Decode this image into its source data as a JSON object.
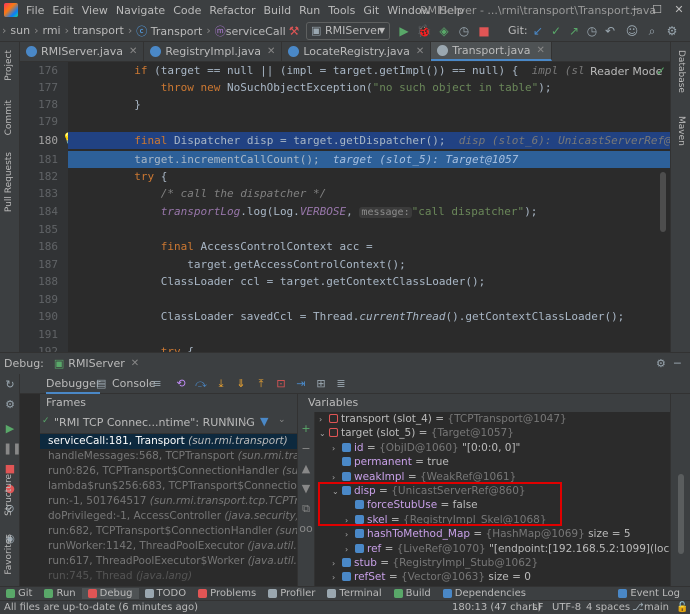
{
  "window": {
    "title": "RMIServer - ...\\rmi\\transport\\Transport.java",
    "menu": [
      "File",
      "Edit",
      "View",
      "Navigate",
      "Code",
      "Refactor",
      "Build",
      "Run",
      "Tools",
      "Git",
      "Window",
      "Help"
    ]
  },
  "breadcrumb": [
    "sun",
    "rmi",
    "transport",
    "Transport",
    "serviceCall"
  ],
  "run_config": "RMIServer",
  "git_label": "Git:",
  "tabs": [
    {
      "label": "RMIServer.java",
      "color": "#4a88c7",
      "active": false
    },
    {
      "label": "RegistryImpl.java",
      "color": "#4a88c7",
      "active": false
    },
    {
      "label": "LocateRegistry.java",
      "color": "#4a88c7",
      "active": false
    },
    {
      "label": "Transport.java",
      "color": "#9aa7b0",
      "active": true
    }
  ],
  "left_strip": [
    "Project",
    "Commit",
    "Pull Requests"
  ],
  "right_strip": [
    "Database",
    "Maven"
  ],
  "reader_mode": "Reader Mode",
  "editor": {
    "line_numbers": [
      "176",
      "177",
      "178",
      "179",
      "180",
      "181",
      "182",
      "183",
      "184",
      "185",
      "186",
      "187",
      "188",
      "189",
      "190",
      "191",
      "192"
    ],
    "line_176": {
      "kw": "if",
      "code": " (target == null || (impl = target.getImpl()) == null) {",
      "hint": "impl (sl"
    },
    "line_177": {
      "kw": "throw new",
      "code": " NoSuchObjectException(",
      "str": "\"no such object in table\"",
      "end": ");"
    },
    "line_178": "}",
    "line_180": {
      "kw": "final",
      "code": " Dispatcher disp = target.getDispatcher();",
      "hint": "disp (slot_6): UnicastServerRef@860"
    },
    "line_181": {
      "code": "target.incrementCallCount();",
      "hint": "target (slot_5): Target@1057"
    },
    "line_182": {
      "kw": "try",
      "code": " {"
    },
    "line_183": "/* call the dispatcher */",
    "line_184": {
      "obj": "transportLog",
      "code": ".log(Log.",
      "field": "VERBOSE",
      "sep": ", ",
      "param": "message:",
      "str": "\"call dispatcher\"",
      "end": ");"
    },
    "line_186": {
      "kw": "final",
      "code": " AccessControlContext acc ="
    },
    "line_187": "target.getAccessControlContext();",
    "line_188": "ClassLoader ccl = target.getContextClassLoader();",
    "line_190": {
      "pre": "ClassLoader savedCcl = Thread.",
      "ital": "currentThread",
      "post": "().getContextClassLoader();"
    },
    "line_192": {
      "kw": "try",
      "code": " {"
    }
  },
  "debug": {
    "label": "Debug:",
    "config": "RMIServer",
    "tabs": [
      "Debugger",
      "Console"
    ],
    "frames_header": "Frames",
    "variables_header": "Variables",
    "thread": "\"RMI TCP Connec...ntime\": RUNNING",
    "frames": [
      {
        "method": "serviceCall:181, Transport",
        "cls": "(sun.rmi.transport)"
      },
      {
        "method": "handleMessages:568, TCPTransport",
        "cls": "(sun.rmi.transport.tcp)"
      },
      {
        "method": "run0:826, TCPTransport$ConnectionHandler",
        "cls": "(sun.rmi.tran"
      },
      {
        "method": "lambda$run$256:683, TCPTransport$ConnectionHandler",
        "cls": "(sun.rmi.tran"
      },
      {
        "method": "run:-1, 501764517",
        "cls": "(sun.rmi.transport.tcp.TCPTransport$C"
      },
      {
        "method": "doPrivileged:-1, AccessController",
        "cls": "(java.security)"
      },
      {
        "method": "run:682, TCPTransport$ConnectionHandler",
        "cls": "(sun.rmi.tran"
      },
      {
        "method": "runWorker:1142, ThreadPoolExecutor",
        "cls": "(java.util.concurrent)"
      },
      {
        "method": "run:617, ThreadPoolExecutor$Worker",
        "cls": "(java.util.concurren"
      },
      {
        "method": "run:745, Thread",
        "cls": "(java.lang)"
      }
    ],
    "variables": [
      {
        "indent": 0,
        "arrow": "›",
        "name": "transport (slot_4)",
        "eq": " = ",
        "type": "{TCPTransport@1047}",
        "val": ""
      },
      {
        "indent": 0,
        "arrow": "⌄",
        "name": "target (slot_5)",
        "eq": " = ",
        "type": "{Target@1057}",
        "val": ""
      },
      {
        "indent": 1,
        "arrow": "›",
        "name": "id",
        "eq": " = ",
        "type": "{ObjID@1060}",
        "val": " \"[0:0:0, 0]\""
      },
      {
        "indent": 1,
        "arrow": "",
        "name": "permanent",
        "eq": " = ",
        "type": "",
        "val": "true"
      },
      {
        "indent": 1,
        "arrow": "›",
        "name": "weakImpl",
        "eq": " = ",
        "type": "{WeakRef@1061}",
        "val": ""
      },
      {
        "indent": 1,
        "arrow": "⌄",
        "name": "disp",
        "eq": " = ",
        "type": "{UnicastServerRef@860}",
        "val": ""
      },
      {
        "indent": 2,
        "arrow": "",
        "name": "forceStubUse",
        "eq": " = ",
        "type": "",
        "val": "false"
      },
      {
        "indent": 2,
        "arrow": "›",
        "name": "skel",
        "eq": " = ",
        "type": "{RegistryImpl_Skel@1068}",
        "val": ""
      },
      {
        "indent": 2,
        "arrow": "›",
        "name": "hashToMethod_Map",
        "eq": " = ",
        "type": "{HashMap@1069}",
        "val": "  size = 5"
      },
      {
        "indent": 2,
        "arrow": "›",
        "name": "ref",
        "eq": " = ",
        "type": "{LiveRef@1070}",
        "val": " \"[endpoint:[192.168.5.2:1099](local),objID:[0:0:0,"
      },
      {
        "indent": 1,
        "arrow": "›",
        "name": "stub",
        "eq": " = ",
        "type": "{RegistryImpl_Stub@1062}",
        "val": ""
      },
      {
        "indent": 1,
        "arrow": "›",
        "name": "refSet",
        "eq": " = ",
        "type": "{Vector@1063}",
        "val": "  size = 0"
      }
    ],
    "left_labels": [
      "Structure",
      "Favorites"
    ]
  },
  "bottom_toolbar": [
    "Git",
    "Run",
    "Debug",
    "TODO",
    "Problems",
    "Profiler",
    "Terminal",
    "Build",
    "Dependencies",
    "Event Log"
  ],
  "status": {
    "left": "All files are up-to-date (6 minutes ago)",
    "position": "180:13 (47 chars)",
    "line_sep": "LF",
    "encoding": "UTF-8",
    "indent": "4 spaces",
    "branch": "main"
  },
  "colors": {
    "accent": "#4a88c7",
    "selection": "#214283",
    "highlight_box": "#e00000"
  }
}
